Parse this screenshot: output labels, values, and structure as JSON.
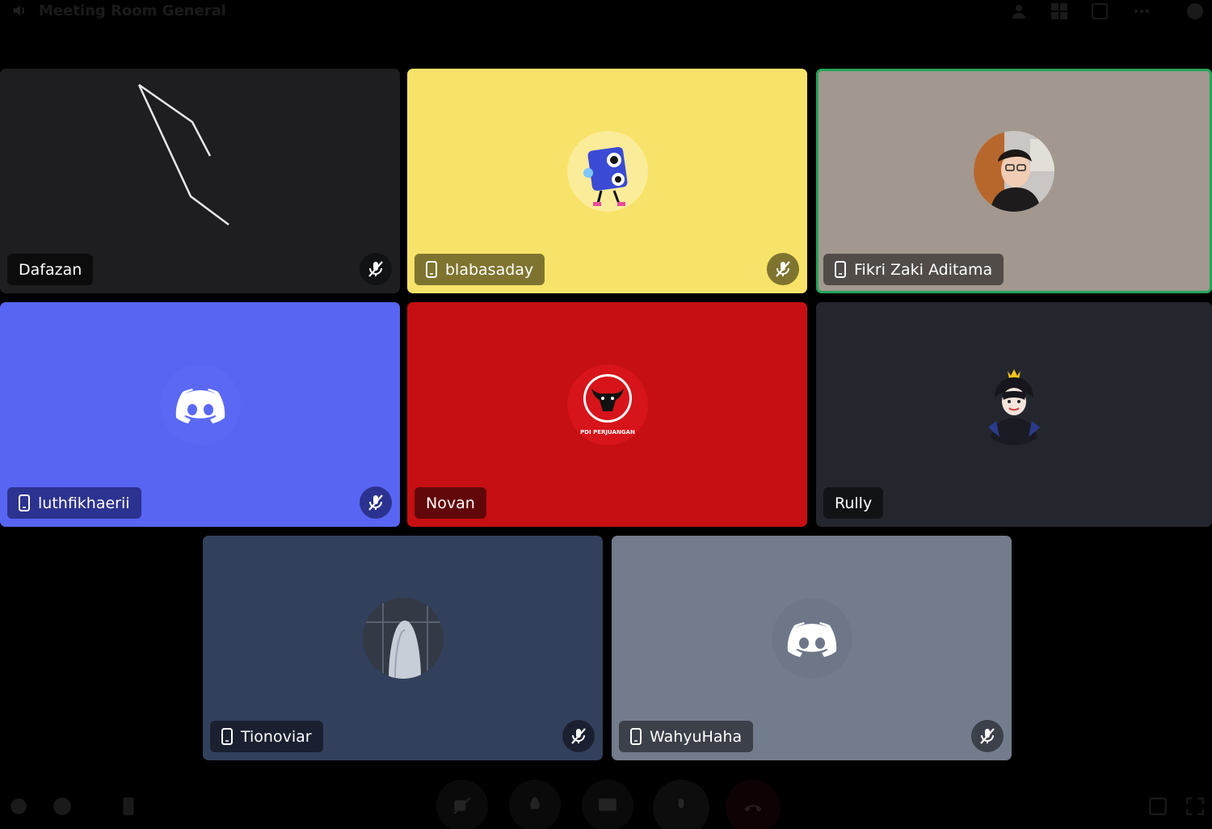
{
  "window": {
    "title": "Meeting Room General",
    "icons": [
      "speaker-icon",
      "add-user-icon",
      "grid-icon",
      "popout-icon",
      "more-icon",
      "chat-icon"
    ]
  },
  "participants": [
    {
      "name": "Dafazan",
      "mobile": false,
      "muted": true,
      "speaking": false,
      "bg": "#1e1e20",
      "avatar": "video-stream"
    },
    {
      "name": "blabasaday",
      "mobile": true,
      "muted": true,
      "speaking": false,
      "bg": "#f8e36a",
      "avatar": "speaker-mascot-avatar"
    },
    {
      "name": "Fikri Zaki Aditama",
      "mobile": true,
      "muted": false,
      "speaking": true,
      "bg": "#a2988f",
      "avatar": "photo-avatar"
    },
    {
      "name": "luthfikhaerii",
      "mobile": true,
      "muted": true,
      "speaking": false,
      "bg": "#5865f2",
      "avatar": "discord-default-avatar"
    },
    {
      "name": "Novan",
      "mobile": false,
      "muted": false,
      "speaking": false,
      "bg": "#c50f12",
      "avatar": "bull-logo-avatar",
      "avatar_text": "PDI PERJUANGAN"
    },
    {
      "name": "Rully",
      "mobile": false,
      "muted": false,
      "speaking": false,
      "bg": "#24262e",
      "avatar": "anime-character-avatar"
    },
    {
      "name": "Tionoviar",
      "mobile": true,
      "muted": true,
      "speaking": false,
      "bg": "#33405b",
      "avatar": "ghost-photo-avatar"
    },
    {
      "name": "WahyuHaha",
      "mobile": true,
      "muted": true,
      "speaking": false,
      "bg": "#737c8c",
      "avatar": "discord-default-avatar"
    }
  ],
  "toolbar": {
    "left_icons": [
      "activity-icon",
      "emoji-icon",
      "phone-icon"
    ],
    "center_icons": [
      "camera-off-icon",
      "activities-rocket-icon",
      "screen-share-icon",
      "microphone-icon",
      "disconnect-icon"
    ],
    "right_icons": [
      "popout-icon",
      "fullscreen-icon"
    ]
  },
  "colors": {
    "background": "#000000",
    "speaking_ring": "#23a55a"
  }
}
